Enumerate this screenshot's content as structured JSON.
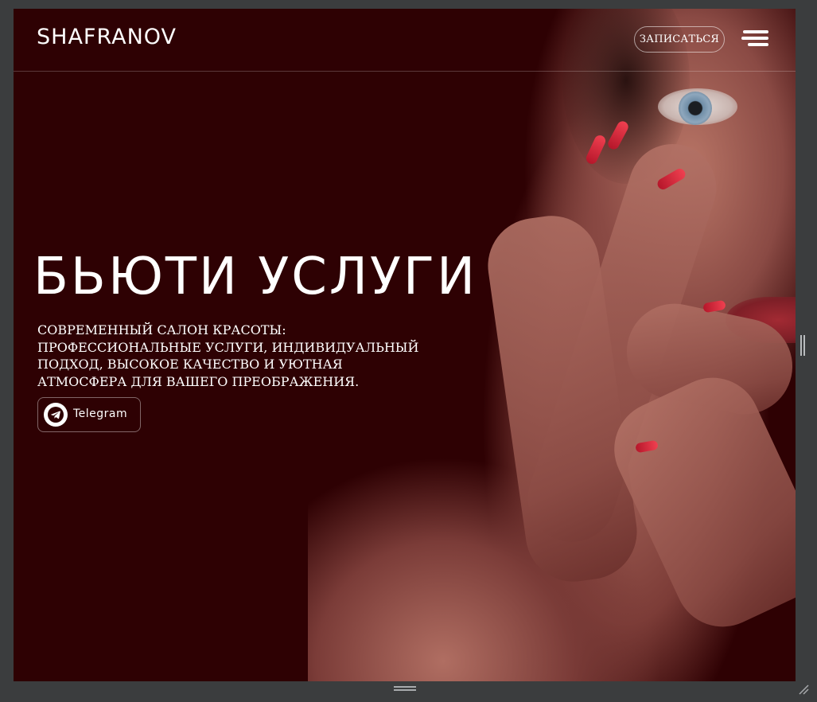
{
  "header": {
    "logo": "SHAFRANOV",
    "signup_label": "ЗАПИСАТЬСЯ",
    "menu_icon": "hamburger-menu-icon"
  },
  "hero": {
    "title": "БЬЮТИ  УСЛУГИ",
    "description": "Современный салон красоты: профессиональные услуги, индивидуальный подход, высокое качество и уютная атмосфера для вашего преображения.",
    "telegram_label": "Telegram",
    "telegram_icon": "telegram-icon",
    "image": "portrait-photo"
  },
  "colors": {
    "background": "#2e0103",
    "text": "#ffffff",
    "frame": "#3b3d3e"
  }
}
